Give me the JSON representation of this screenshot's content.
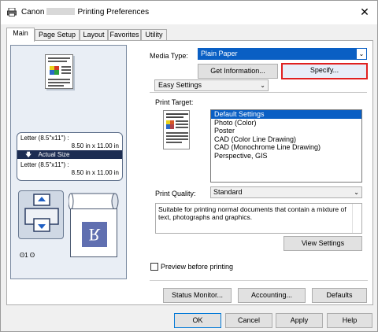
{
  "window": {
    "title_prefix": "Canon",
    "title_suffix": "Printing Preferences",
    "close_label": "✕"
  },
  "tabs": [
    {
      "label": "Main",
      "active": true
    },
    {
      "label": "Page Setup",
      "active": false
    },
    {
      "label": "Layout",
      "active": false
    },
    {
      "label": "Favorites",
      "active": false
    },
    {
      "label": "Utility",
      "active": false
    }
  ],
  "preview": {
    "size_line1": "Letter (8.5\"x11\") :",
    "size_line2": "8.50 in x 11.00 in",
    "actual_size": "Actual Size",
    "size_line3": "Letter (8.5\"x11\") :",
    "size_line4": "8.50 in x 11.00 in",
    "sheet_glyph": "R",
    "icons_text": "ʘ1 ʘ"
  },
  "media": {
    "label": "Media Type:",
    "value": "Plain Paper",
    "get_info_button": "Get Information...",
    "specify_button": "Specify..."
  },
  "settings": {
    "mode_value": "Easy Settings",
    "print_target_label": "Print Target:",
    "targets": [
      "Default Settings",
      "Photo (Color)",
      "Poster",
      "CAD (Color Line Drawing)",
      "CAD (Monochrome Line Drawing)",
      "Perspective, GIS"
    ],
    "selected_target": "Default Settings",
    "quality_label": "Print Quality:",
    "quality_value": "Standard",
    "description": "Suitable for printing normal documents that contain a mixture of text, photographs and graphics.",
    "view_settings_button": "View Settings"
  },
  "preview_option": {
    "label": "Preview before printing",
    "checked": false
  },
  "bottom_buttons": {
    "status_monitor": "Status Monitor...",
    "accounting": "Accounting...",
    "defaults": "Defaults"
  },
  "footer": {
    "ok": "OK",
    "cancel": "Cancel",
    "apply": "Apply",
    "help": "Help"
  },
  "colors": {
    "selection_blue": "#0a5fc4",
    "highlight_red": "#e02020",
    "preview_navy": "#1d2d52"
  }
}
